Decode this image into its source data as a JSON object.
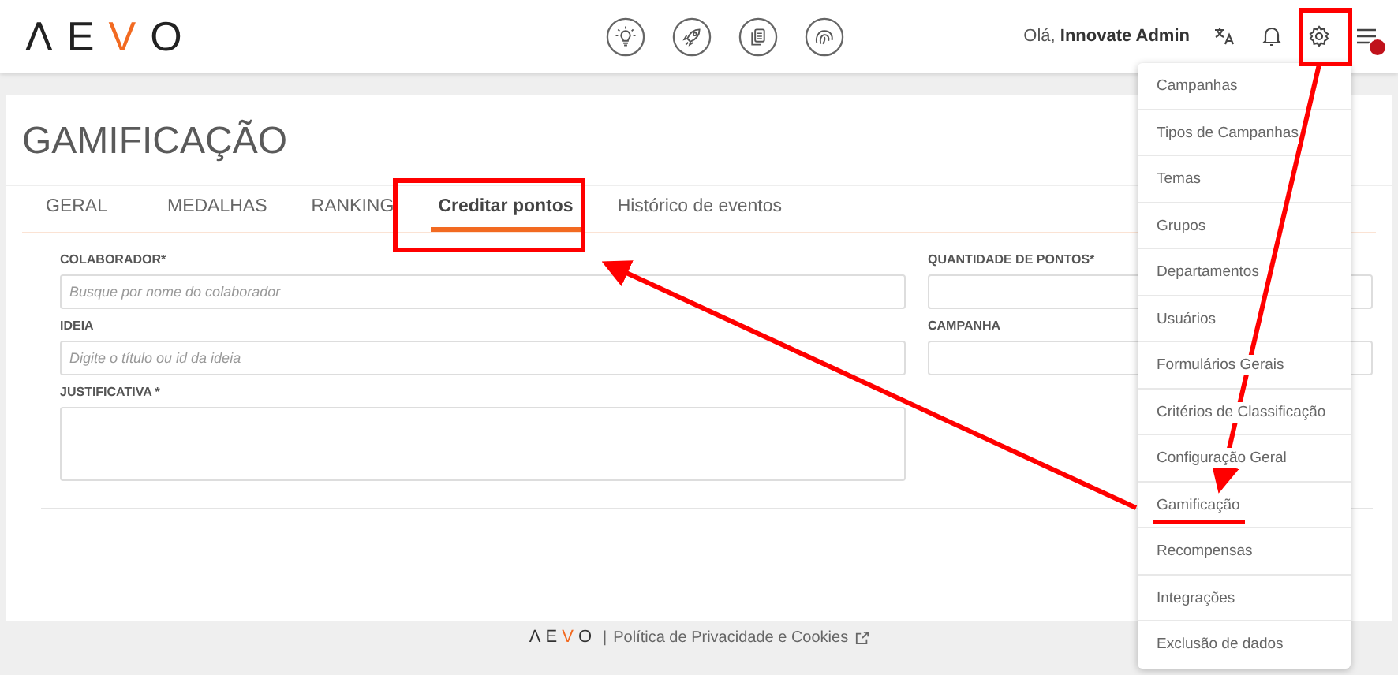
{
  "header": {
    "logo": "ΛEVO",
    "greeting": "Olá, **Innovate Admin**"
  },
  "page": {
    "title": "GAMIFICAÇÃO"
  },
  "tabs": [
    {
      "label": "GERAL",
      "selected": false
    },
    {
      "label": "MEDALHAS",
      "selected": false
    },
    {
      "label": "RANKING",
      "selected": false
    },
    {
      "label": "Creditar pontos",
      "selected": true
    },
    {
      "label": "Histórico de eventos",
      "selected": false
    }
  ],
  "form": {
    "left": [
      {
        "label": "COLABORADOR*",
        "placeholder": "Busque por nome do colaborador",
        "kind": "input"
      },
      {
        "label": "IDEIA",
        "placeholder": "Digite o título ou id da ideia",
        "kind": "input"
      },
      {
        "label": "JUSTIFICATIVA *",
        "kind": "textarea"
      }
    ],
    "right": [
      {
        "label": "QUANTIDADE DE PONTOS*"
      },
      {
        "label": "CAMPANHA"
      }
    ]
  },
  "settings_menu": [
    {
      "label": "Campanhas"
    },
    {
      "label": "Tipos de Campanhas"
    },
    {
      "label": "Temas"
    },
    {
      "label": "Grupos"
    },
    {
      "label": "Departamentos"
    },
    {
      "label": "Usuários"
    },
    {
      "label": "Formulários Gerais"
    },
    {
      "label": "Critérios de Classificação"
    },
    {
      "label": "Configuração Geral"
    },
    {
      "label": "Gamificação"
    },
    {
      "label": "Recompensas"
    },
    {
      "label": "Integrações"
    },
    {
      "label": "Exclusão de dados"
    }
  ],
  "footer": {
    "logo": "ΛEVO",
    "separator": "|",
    "link": "Política de Privacidade e Cookies"
  }
}
